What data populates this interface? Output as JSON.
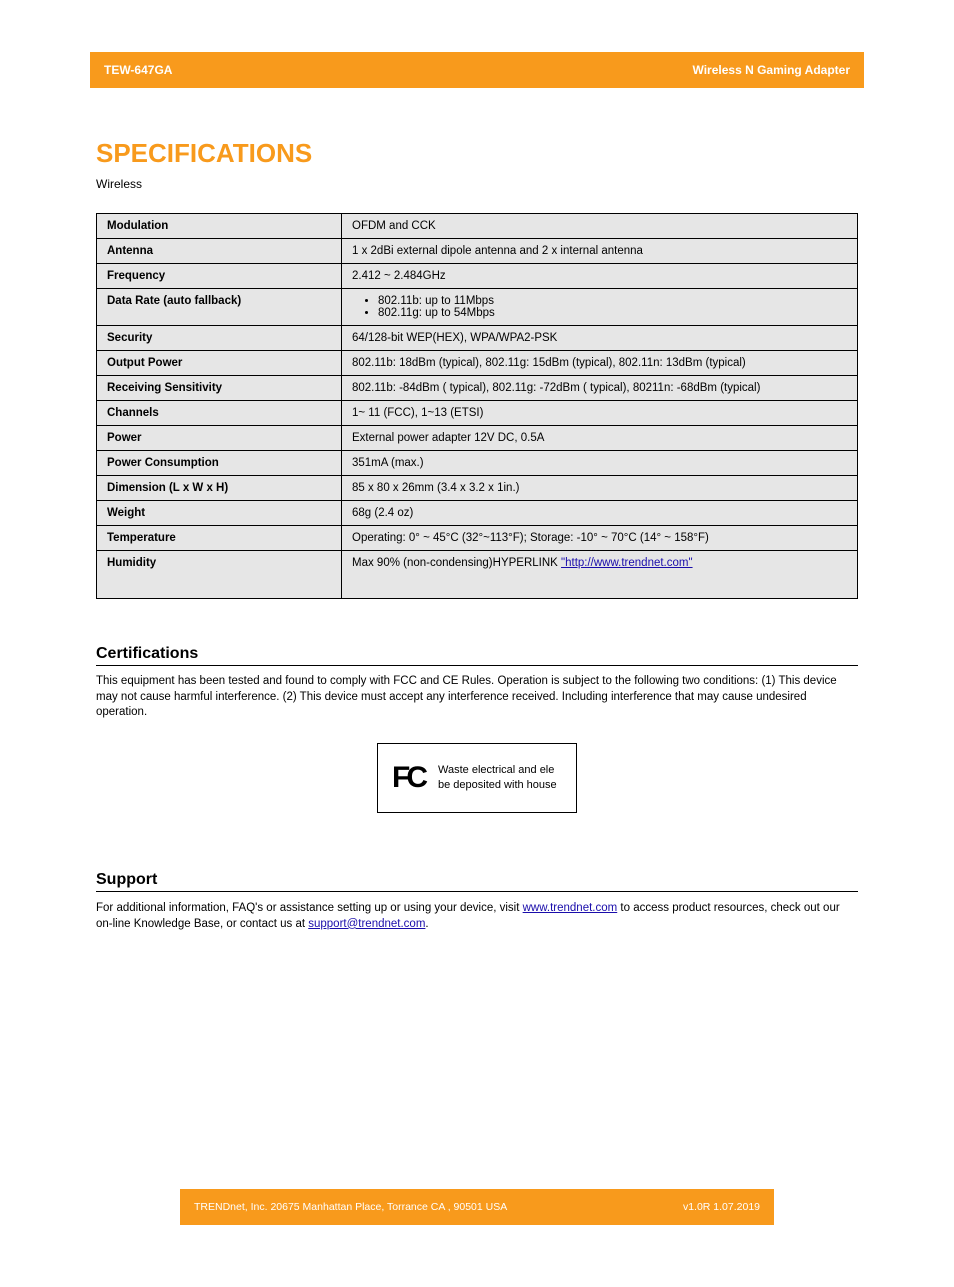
{
  "header": {
    "left": "TEW-647GA",
    "right": "Wireless N Gaming Adapter"
  },
  "section": {
    "title": "SPECIFICATIONS",
    "subtitle": "Wireless"
  },
  "specs": {
    "rows": [
      {
        "label": "Modulation",
        "value": "OFDM and CCK"
      },
      {
        "label": "Antenna",
        "value": "1 x 2dBi external dipole antenna and 2 x internal antenna"
      },
      {
        "label": "Frequency",
        "value": "2.412 ~ 2.484GHz"
      },
      {
        "label": "Data Rate (auto fallback)",
        "bullets": [
          "802.11b: up to 11Mbps",
          "802.11g: up to 54Mbps"
        ]
      },
      {
        "label": "Security",
        "value": "64/128-bit WEP(HEX), WPA/WPA2-PSK"
      },
      {
        "label": "Output Power",
        "value": "802.11b: 18dBm (typical), 802.11g: 15dBm (typical), 802.11n: 13dBm (typical)"
      },
      {
        "label": "Receiving Sensitivity",
        "value": "802.11b: -84dBm ( typical), 802.11g: -72dBm ( typical), 80211n: -68dBm (typical)"
      },
      {
        "label": "Channels",
        "value": "1~ 11 (FCC), 1~13 (ETSI)"
      },
      {
        "label": "Power",
        "value": "External power adapter  12V DC, 0.5A"
      },
      {
        "label": "Power Consumption",
        "value": "351mA (max.)"
      },
      {
        "label": "Dimension (L x W x H)",
        "value": "85 x 80 x 26mm (3.4 x 3.2 x 1in.)"
      },
      {
        "label": "Weight",
        "value": "68g (2.4 oz)"
      },
      {
        "label": "Temperature",
        "value": "Operating: 0° ~ 45°C (32°~113°F); Storage: -10° ~ 70°C (14° ~ 158°F)"
      },
      {
        "label": "Humidity",
        "value_prefix": "Max 90% (non-condensing)HYPERLINK ",
        "link_text": "\"http://www.trendnet.com\"",
        "link_href": "http://www.trendnet.com"
      }
    ]
  },
  "certifications": {
    "heading": "Certifications",
    "text": "This equipment has been tested and found to comply with FCC and CE Rules. Operation is subject to the following two conditions:\n(1) This device may not cause harmful interference.\n(2) This device must accept any interference received. Including interference that may cause undesired operation.",
    "box": {
      "line1": "Waste electrical and ele",
      "line2": "be deposited with house"
    }
  },
  "support": {
    "heading": "Support",
    "text_prefix": "For additional information, FAQ's or assistance setting up or using your device, visit ",
    "link1_text": "www.trendnet.com",
    "link1_href": "http://www.trendnet.com",
    "text_mid": " to access product resources, check out our on-line Knowledge Base, or contact us at ",
    "link2_text": "support@trendnet.com",
    "link2_href": "mailto:support@trendnet.com",
    "text_suffix": "."
  },
  "footer": {
    "left": "TRENDnet, Inc.  20675 Manhattan Place, Torrance CA , 90501 USA",
    "right": "v1.0R 1.07.2019"
  }
}
